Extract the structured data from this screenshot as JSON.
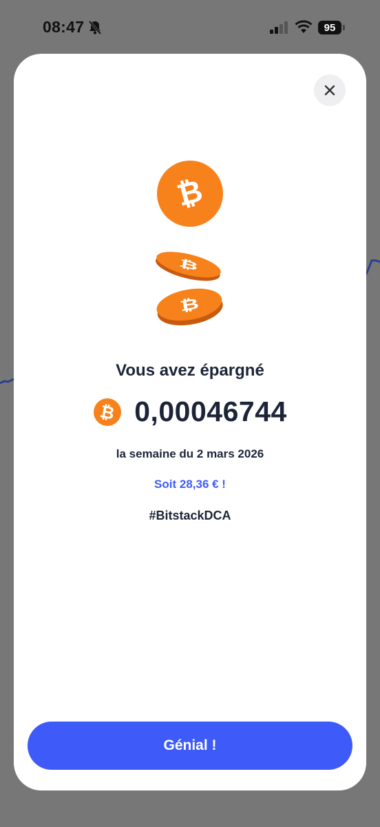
{
  "status_bar": {
    "time": "08:47",
    "battery": "95",
    "icons": [
      "bell-slash-icon",
      "cellular-signal-icon",
      "wifi-icon",
      "battery-icon"
    ]
  },
  "modal": {
    "close_icon": "close-icon",
    "illustration": "bitcoin-coins-illustration",
    "headline": "Vous avez épargné",
    "amount": "0,00046744",
    "amount_icon": "bitcoin-icon",
    "period": "la semaine du 2 mars 2026",
    "equivalent": "Soit 28,36 € !",
    "hashtag": "#BitstackDCA",
    "cta_label": "Génial !"
  },
  "colors": {
    "bitcoin_orange": "#f7821b",
    "bitcoin_dark": "#c85a10",
    "accent_blue": "#3e5bfa",
    "text_dark": "#1c2538",
    "overlay": "#777777"
  }
}
